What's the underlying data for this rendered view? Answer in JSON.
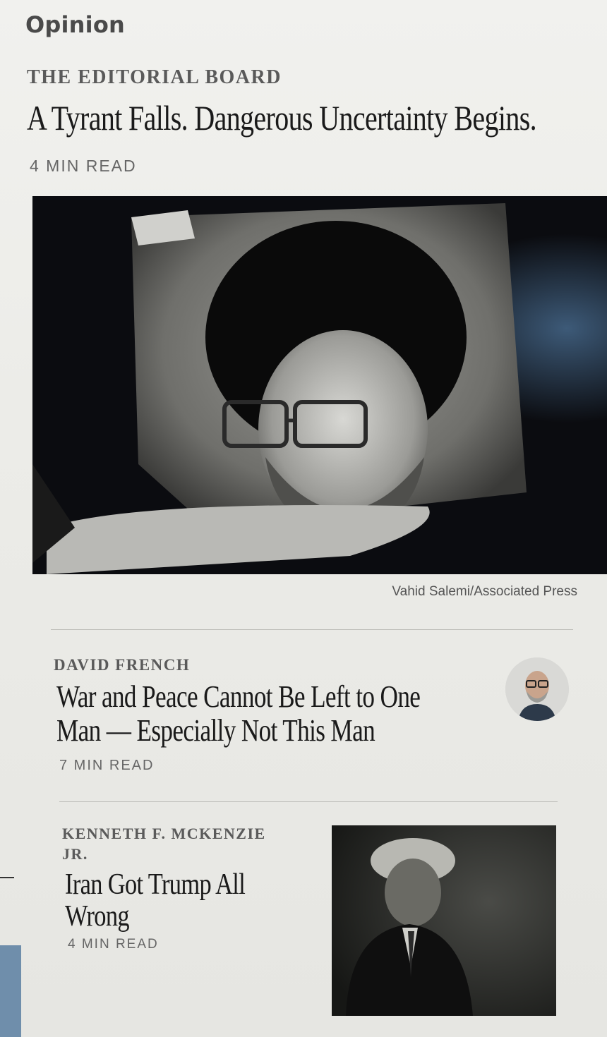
{
  "section": {
    "label": "Opinion"
  },
  "lead": {
    "kicker": "THE EDITORIAL BOARD",
    "headline": "A Tyrant Falls. Dangerous Uncertainty Begins.",
    "read_time": "4 MIN READ",
    "image_credit": "Vahid Salemi/Associated Press"
  },
  "stories": [
    {
      "kicker": "DAVID FRENCH",
      "headline": "War and Peace Cannot Be Left to One Man — Especially Not This Man",
      "read_time": "7 MIN READ"
    },
    {
      "kicker": "KENNETH F. MCKENZIE JR.",
      "headline": "Iran Got Trump All Wrong",
      "read_time": "4 MIN READ"
    }
  ],
  "colors": {
    "background": "#ecece8",
    "headline": "#1a1a1a",
    "kicker": "#5a5a5a",
    "divider": "#bdbdb8"
  }
}
